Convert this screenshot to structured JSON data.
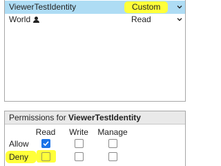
{
  "identities": [
    {
      "name": "ViewerTestIdentity",
      "permission": "Custom",
      "selected": true,
      "highlighted": true
    },
    {
      "name": "World",
      "permission": "Read",
      "selected": false,
      "has_user_icon": true,
      "icon": "user-icon"
    }
  ],
  "permissions_panel": {
    "title_prefix": "Permissions for",
    "identity": "ViewerTestIdentity",
    "columns": [
      "Read",
      "Write",
      "Manage"
    ],
    "rows": [
      {
        "label": "Allow",
        "checks": [
          true,
          false,
          false
        ]
      },
      {
        "label": "Deny",
        "checks": [
          false,
          false,
          false
        ],
        "highlighted": true
      }
    ]
  },
  "colors": {
    "selected_row": "#aedcf4",
    "highlight": "#ffff3a",
    "checkbox_checked": "#1a73e8",
    "panel_header": "#e9e9e9"
  }
}
